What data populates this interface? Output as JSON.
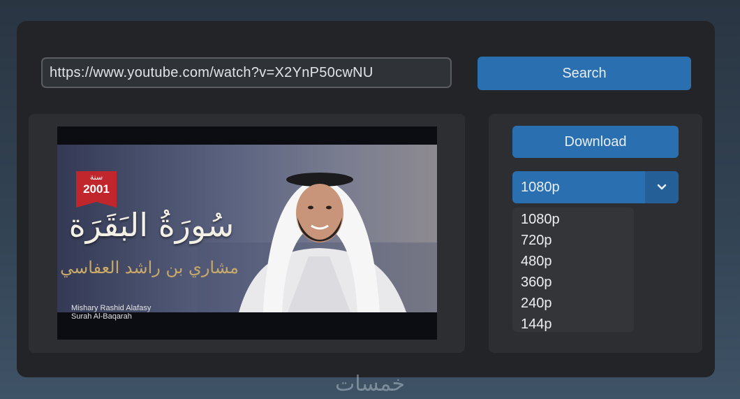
{
  "search": {
    "url_value": "https://www.youtube.com/watch?v=X2YnP50cwNU",
    "button_label": "Search"
  },
  "thumbnail": {
    "badge_label": "سنة",
    "badge_year": "2001",
    "title_ar": "سُورَةُ البَقَرَة",
    "reciter_ar": "مشاري بن راشد العفاسي",
    "reciter_en": "Mishary Rashid Alafasy",
    "surah_en": "Surah Al-Baqarah"
  },
  "download": {
    "button_label": "Download",
    "selected_quality": "1080p",
    "quality_options": [
      "1080p",
      "720p",
      "480p",
      "360p",
      "240p",
      "144p"
    ]
  },
  "watermark": "خمسات",
  "colors": {
    "accent": "#2a6fb0",
    "panel": "#2c2e32",
    "window": "#222427"
  }
}
